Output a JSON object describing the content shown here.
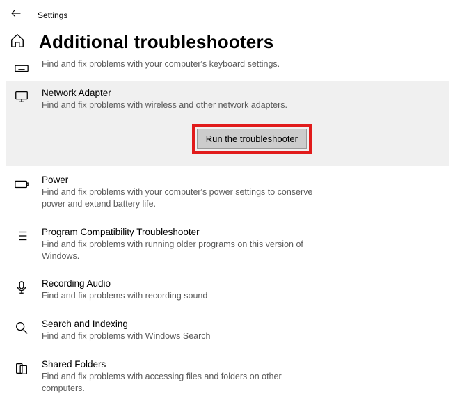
{
  "window": {
    "app_title": "Settings"
  },
  "page": {
    "title": "Additional troubleshooters"
  },
  "items": {
    "keyboard": {
      "title": "",
      "desc": "Find and fix problems with your computer's keyboard settings."
    },
    "network": {
      "title": "Network Adapter",
      "desc": "Find and fix problems with wireless and other network adapters.",
      "run_label": "Run the troubleshooter"
    },
    "power": {
      "title": "Power",
      "desc": "Find and fix problems with your computer's power settings to conserve power and extend battery life."
    },
    "compat": {
      "title": "Program Compatibility Troubleshooter",
      "desc": "Find and fix problems with running older programs on this version of Windows."
    },
    "recording": {
      "title": "Recording Audio",
      "desc": "Find and fix problems with recording sound"
    },
    "search": {
      "title": "Search and Indexing",
      "desc": "Find and fix problems with Windows Search"
    },
    "shared": {
      "title": "Shared Folders",
      "desc": "Find and fix problems with accessing files and folders on other computers."
    }
  }
}
